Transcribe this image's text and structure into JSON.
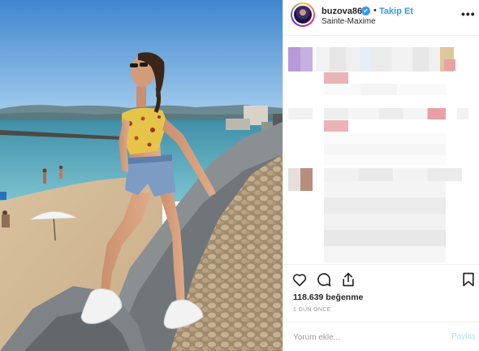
{
  "post": {
    "username": "buzova86",
    "verified_mark": "✔",
    "separator": "•",
    "follow_label": "Takip Et",
    "location": "Sainte-Maxime",
    "more_label": "•••",
    "likes": "118.639 beğenme",
    "time_ago": "1 GÜN ÖNCE",
    "comment_placeholder": "Yorum ekle...",
    "post_label": "Paylaş"
  },
  "icons": {
    "like": "heart-icon",
    "comment": "comment-icon",
    "share": "share-icon",
    "save": "bookmark-icon",
    "verified": "verified-badge-icon"
  },
  "colors": {
    "link_blue": "#3897f0",
    "post_disabled": "#b2dffc",
    "muted": "#999999",
    "text": "#262626",
    "divider": "#efefef"
  }
}
